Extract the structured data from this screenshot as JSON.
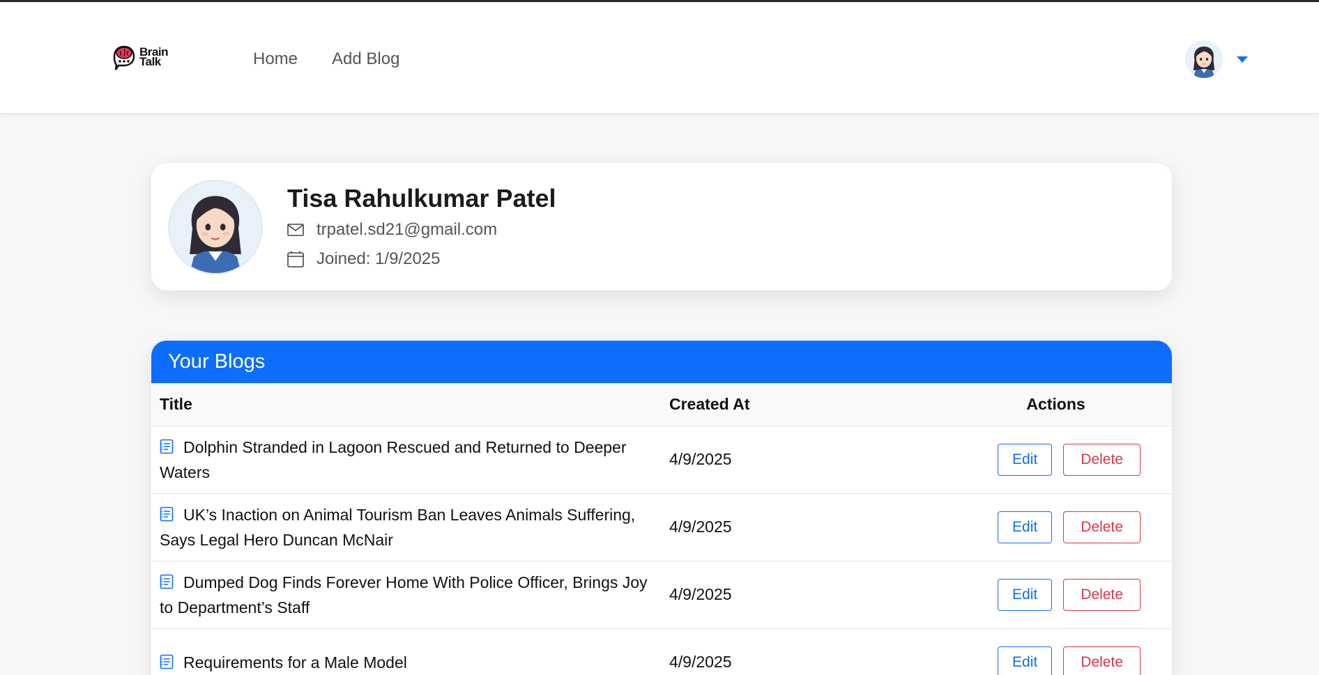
{
  "brand": {
    "line1": "Brain",
    "line2": "Talk",
    "icon": "brain-chat-logo"
  },
  "nav": {
    "home": "Home",
    "add_blog": "Add Blog"
  },
  "user_menu": {
    "avatar": "user-avatar",
    "caret_icon": "caret-down-icon"
  },
  "profile": {
    "name": "Tisa Rahulkumar Patel",
    "email": "trpatel.sd21@gmail.com",
    "email_icon": "envelope-icon",
    "joined": "Joined: 1/9/2025",
    "joined_icon": "calendar-icon"
  },
  "blogs": {
    "header": "Your Blogs",
    "columns": {
      "title": "Title",
      "created_at": "Created At",
      "actions": "Actions"
    },
    "edit_label": "Edit",
    "delete_label": "Delete",
    "rows": [
      {
        "title": "Dolphin Stranded in Lagoon Rescued and Returned to Deeper Waters",
        "created_at": "4/9/2025"
      },
      {
        "title": "UK’s Inaction on Animal Tourism Ban Leaves Animals Suffering, Says Legal Hero Duncan McNair",
        "created_at": "4/9/2025"
      },
      {
        "title": "Dumped Dog Finds Forever Home With Police Officer, Brings Joy to Department’s Staff",
        "created_at": "4/9/2025"
      },
      {
        "title": "Requirements for a Male Model",
        "created_at": "4/9/2025"
      }
    ]
  },
  "colors": {
    "primary": "#0d6efd",
    "danger": "#dc3545"
  }
}
